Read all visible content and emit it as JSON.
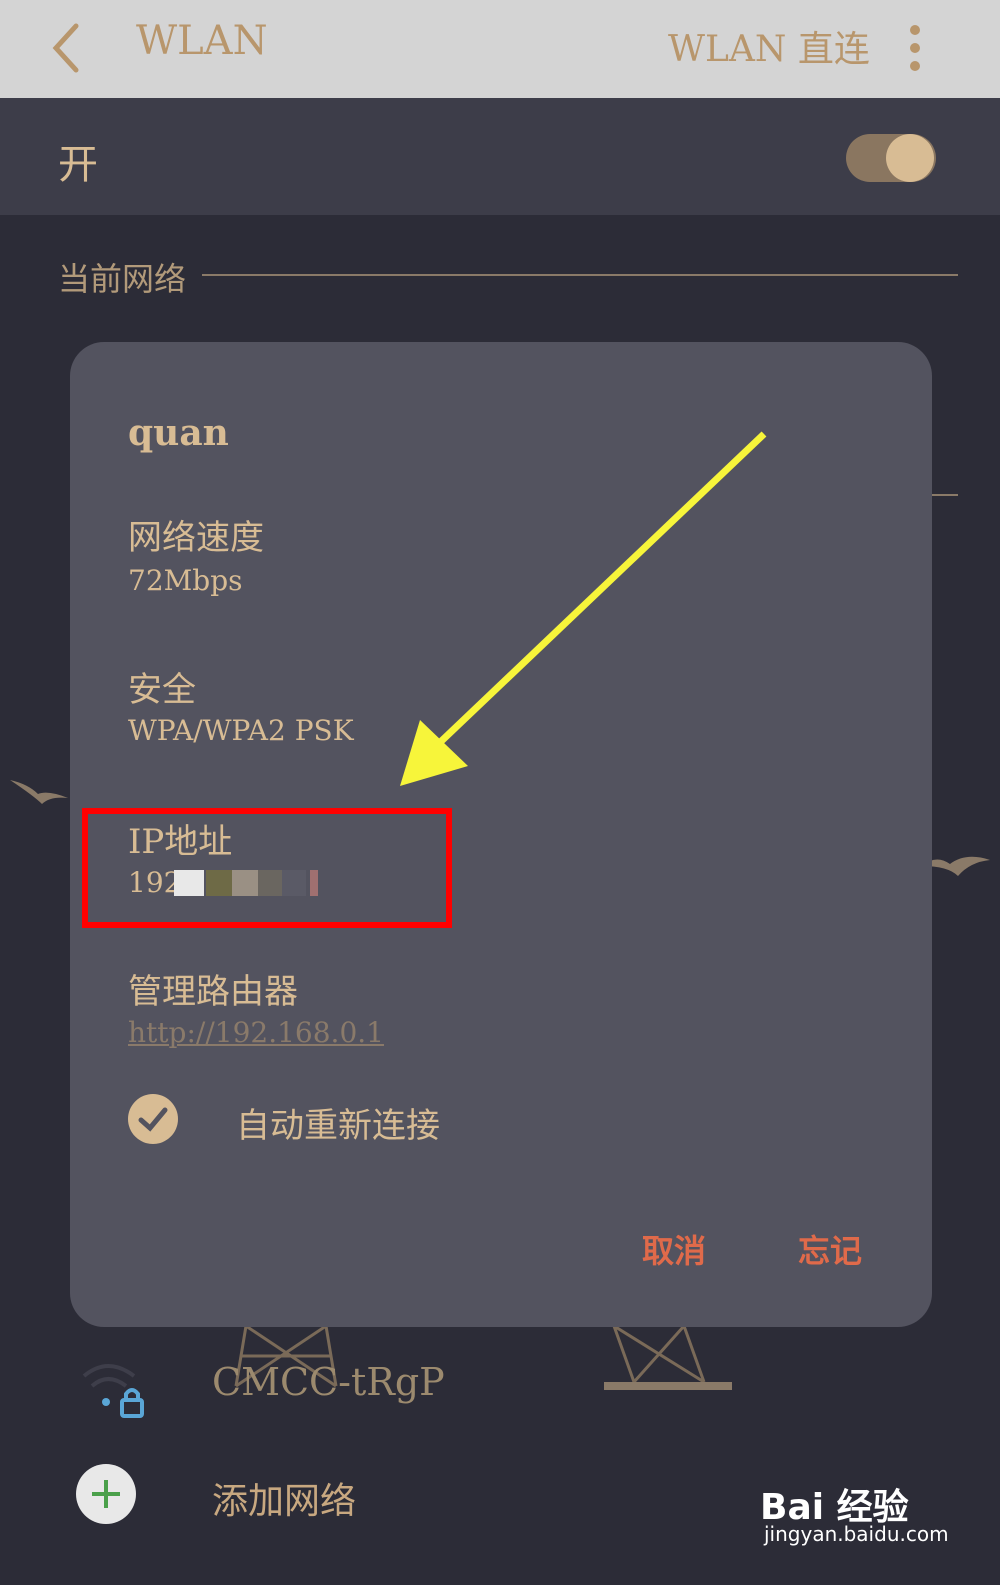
{
  "topbar": {
    "title": "WLAN",
    "action_label": "WLAN 直连"
  },
  "wlan_switch": {
    "label": "开",
    "state": "on"
  },
  "section": {
    "current_network_header": "当前网络"
  },
  "dialog": {
    "network_name": "quan",
    "speed_label": "网络速度",
    "speed_value": "72Mbps",
    "security_label": "安全",
    "security_value": "WPA/WPA2 PSK",
    "ip_label": "IP地址",
    "ip_value": "192",
    "router_label": "管理路由器",
    "router_link": "http://192.168.0.1",
    "auto_reconnect_label": "自动重新连接",
    "auto_reconnect_checked": true,
    "cancel_label": "取消",
    "forget_label": "忘记"
  },
  "networks": {
    "other_network": "CMCC-tRgP",
    "add_network": "添加网络"
  },
  "watermark": {
    "brand": "Bai 经验",
    "url": "jingyan.baidu.com"
  },
  "colors": {
    "accent_text": "#d8bc94",
    "action_red": "#e06a4a",
    "highlight_red": "#ff0000",
    "arrow_yellow": "#f7f53a"
  }
}
